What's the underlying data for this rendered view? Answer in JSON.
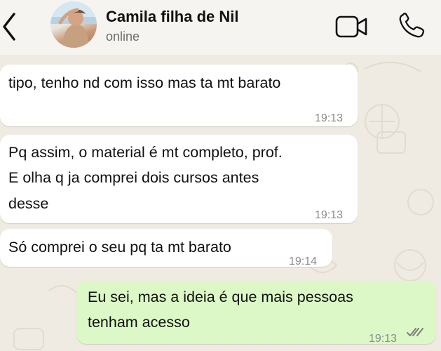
{
  "header": {
    "contact_name": "Camila filha de Nil",
    "status": "online",
    "icons": {
      "back": "chevron-left-icon",
      "video": "video-camera-icon",
      "call": "phone-icon"
    }
  },
  "messages": [
    {
      "direction": "incoming",
      "lines": [
        "tipo, tenho nd com isso mas ta mt barato"
      ],
      "time": "19:13"
    },
    {
      "direction": "incoming",
      "lines": [
        "Pq assim, o material é mt completo, prof.",
        "E olha q ja comprei dois cursos antes",
        "desse"
      ],
      "time": "19:13"
    },
    {
      "direction": "incoming",
      "lines": [
        "Só comprei o seu pq ta mt barato"
      ],
      "time": "19:14"
    },
    {
      "direction": "outgoing",
      "lines": [
        "Eu sei, mas a ideia é que mais pessoas",
        "tenham acesso"
      ],
      "time": "19:13",
      "status": "read-double-check-icon"
    }
  ],
  "colors": {
    "chat_background": "#efeae2",
    "incoming_bubble": "#ffffff",
    "outgoing_bubble": "#dcf8c6",
    "read_ticks": "#7b7b7b"
  }
}
